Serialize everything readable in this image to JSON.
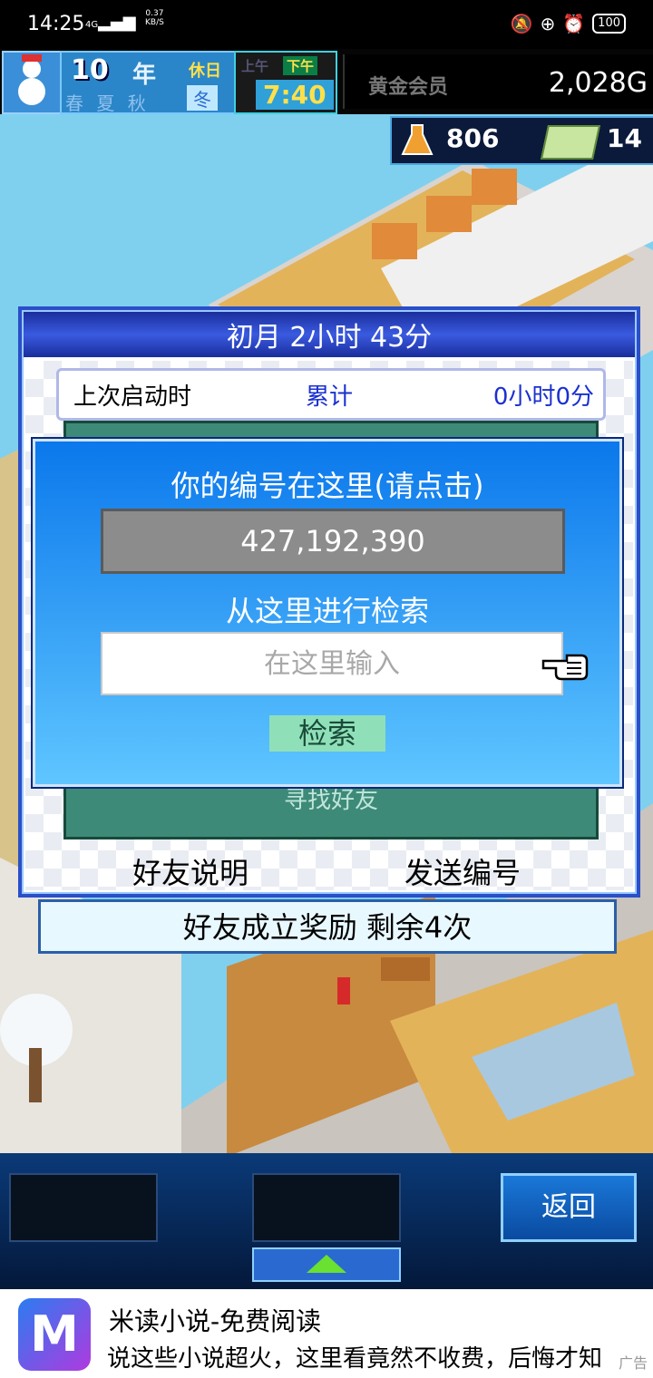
{
  "status_bar": {
    "time": "14:25",
    "signal": "4G",
    "net_speed_value": "0.37",
    "net_speed_unit": "KB/S",
    "battery": "100"
  },
  "game_header": {
    "year_number": "10",
    "year_unit": "年",
    "holiday": "休日",
    "season_row": "春 夏 秋",
    "weather_symbol": "冬",
    "am_label": "上午",
    "pm_label": "下午",
    "clock_time": "7:40",
    "membership": "黄金会员",
    "gold": "2,028G",
    "research_points": "806",
    "tickets": "14"
  },
  "dialog": {
    "header": "初月  2小时 43分",
    "info_label": "上次启动时",
    "info_sub": "累计",
    "info_value": "0小时0分",
    "hidden_button": "寻找好友",
    "left_button": "好友说明",
    "right_button": "发送编号"
  },
  "popup": {
    "title": "你的编号在这里(请点击)",
    "player_id": "427,192,390",
    "search_label": "从这里进行检索",
    "search_placeholder": "在这里输入",
    "search_button": "检索"
  },
  "reward_bar": "好友成立奖励  剩余4次",
  "bottom_menu": {
    "back_button": "返回"
  },
  "ad": {
    "logo_letter": "M",
    "title": "米读小说-免费阅读",
    "description": "说这些小说超火，这里看竟然不收费，后悔才知",
    "tag": "广告"
  },
  "colors": {
    "popup_blue": "#0b78ec",
    "dialog_border": "#2a4fc8",
    "search_button": "#8fe0b8",
    "link_blue": "#1a30d0"
  }
}
